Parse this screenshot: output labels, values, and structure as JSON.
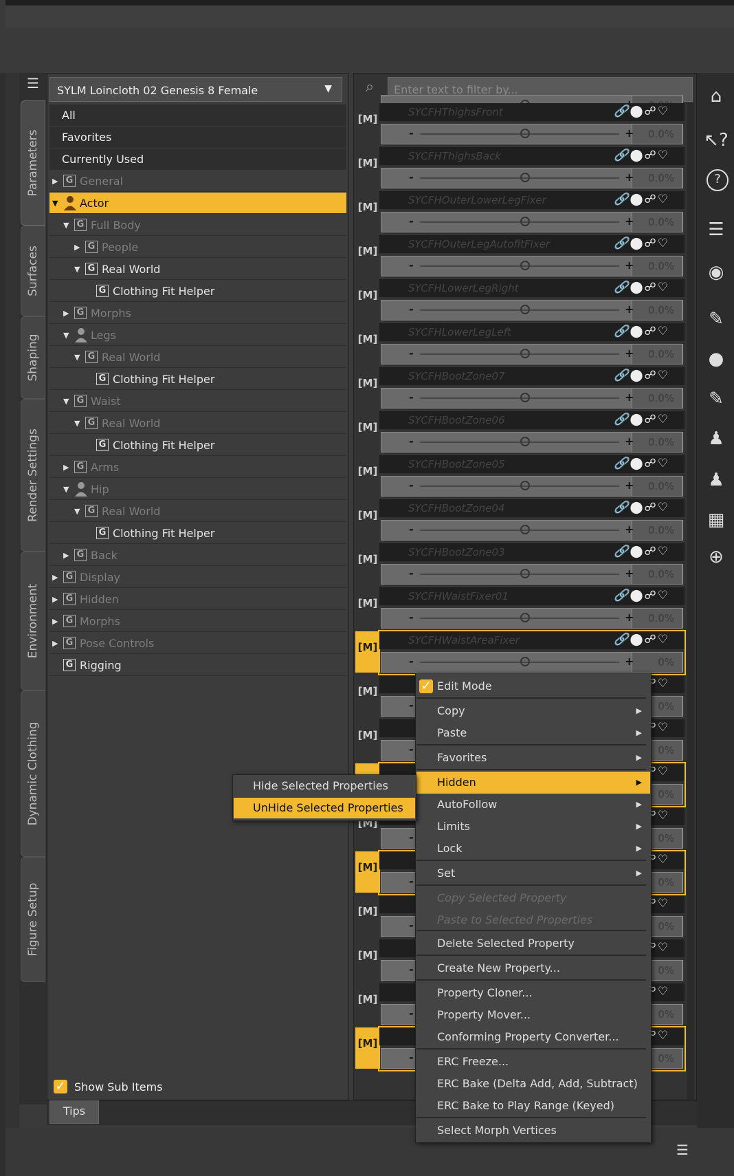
{
  "node_select": "SYLM Loincloth 02 Genesis 8 Female",
  "filter_placeholder": "Enter text to filter by...",
  "vertical_tabs": [
    "Parameters",
    "Surfaces",
    "Shaping",
    "Render Settings",
    "Environment",
    "Dynamic Clothing",
    "Figure Setup"
  ],
  "tree": {
    "top": [
      "All",
      "Favorites",
      "Currently Used"
    ],
    "items": [
      {
        "label": "General",
        "tri": "▶",
        "type": "G",
        "dim": true
      },
      {
        "label": "Actor",
        "tri": "▼",
        "type": "person",
        "sel": true
      },
      {
        "label": "Full Body",
        "tri": "▼",
        "type": "G",
        "dim": true
      },
      {
        "label": "People",
        "tri": "▶",
        "type": "G",
        "dim": true
      },
      {
        "label": "Real World",
        "tri": "▼",
        "type": "G",
        "dim": false
      },
      {
        "label": "Clothing Fit Helper",
        "tri": "",
        "type": "G",
        "dim": false
      },
      {
        "label": "Morphs",
        "tri": "▶",
        "type": "G",
        "dim": true
      },
      {
        "label": "Legs",
        "tri": "▼",
        "type": "person",
        "dim": true
      },
      {
        "label": "Real World",
        "tri": "▼",
        "type": "G",
        "dim": true
      },
      {
        "label": "Clothing Fit Helper",
        "tri": "",
        "type": "G",
        "dim": false
      },
      {
        "label": "Waist",
        "tri": "▼",
        "type": "G",
        "dim": true
      },
      {
        "label": "Real World",
        "tri": "▼",
        "type": "G",
        "dim": true
      },
      {
        "label": "Clothing Fit Helper",
        "tri": "",
        "type": "G",
        "dim": false
      },
      {
        "label": "Arms",
        "tri": "▶",
        "type": "G",
        "dim": true
      },
      {
        "label": "Hip",
        "tri": "▼",
        "type": "person",
        "dim": true
      },
      {
        "label": "Real World",
        "tri": "▼",
        "type": "G",
        "dim": true
      },
      {
        "label": "Clothing Fit Helper",
        "tri": "",
        "type": "G",
        "dim": false
      },
      {
        "label": "Back",
        "tri": "▶",
        "type": "G",
        "dim": true
      },
      {
        "label": "Display",
        "tri": "▶",
        "type": "G",
        "dim": true
      },
      {
        "label": "Hidden",
        "tri": "▶",
        "type": "G",
        "dim": true
      },
      {
        "label": "Morphs",
        "tri": "▶",
        "type": "G",
        "dim": true
      },
      {
        "label": "Pose Controls",
        "tri": "▶",
        "type": "G",
        "dim": true
      },
      {
        "label": "Rigging",
        "tri": "",
        "type": "G",
        "dim": false
      }
    ],
    "show_sub_items": "Show Sub Items"
  },
  "tips_label": "Tips",
  "properties": {
    "m_label": "[M]",
    "value": "0.0%",
    "minus": "-",
    "plus": "+",
    "icons": "🔗⬤☍♡",
    "names": [
      "",
      "SYCFHThighsFront",
      "SYCFHThighsBack",
      "SYCFHOuterLowerLegFixer",
      "SYCFHOuterLegAutofitFixer",
      "SYCFHLowerLegRight",
      "SYCFHLowerLegLeft",
      "SYCFHBootZone07",
      "SYCFHBootZone06",
      "SYCFHBootZone05",
      "SYCFHBootZone04",
      "SYCFHBootZone03",
      "SYCFHWaistFixer01",
      "SYCFHWaistAreaFixer"
    ],
    "lower_value": "0%"
  },
  "context_menu": {
    "items": [
      {
        "label": "Edit Mode",
        "check": true
      },
      {
        "label": "Copy",
        "sub": true
      },
      {
        "label": "Paste",
        "sub": true
      },
      {
        "label": "Favorites",
        "sub": true
      },
      {
        "label": "Hidden",
        "sub": true,
        "hl": true
      },
      {
        "label": "AutoFollow",
        "sub": true
      },
      {
        "label": "Limits",
        "sub": true
      },
      {
        "label": "Lock",
        "sub": true
      },
      {
        "label": "Set",
        "sub": true
      },
      {
        "label": "Copy Selected Property",
        "dis": true
      },
      {
        "label": "Paste to Selected Properties",
        "dis": true
      },
      {
        "label": "Delete Selected Property"
      },
      {
        "label": "Create New Property..."
      },
      {
        "label": "Property Cloner..."
      },
      {
        "label": "Property Mover..."
      },
      {
        "label": "Conforming Property Converter..."
      },
      {
        "label": "ERC Freeze..."
      },
      {
        "label": "ERC Bake (Delta Add, Add, Subtract)"
      },
      {
        "label": "ERC Bake to Play Range (Keyed)"
      },
      {
        "label": "Select Morph Vertices"
      }
    ],
    "submenu": [
      "Hide Selected Properties",
      "UnHide Selected Properties"
    ]
  },
  "right_toolbar_icons": [
    "ds-home-icon",
    "whats-this-icon",
    "help-icon",
    "pane-icon",
    "target-icon",
    "joint-editor-icon",
    "node-icon",
    "weight-map-icon",
    "figure-icon",
    "figure-icon-2",
    "grid-icon",
    "globe-icon"
  ],
  "colors": {
    "accent": "#f2b82f",
    "panel": "#3c3c3c"
  }
}
